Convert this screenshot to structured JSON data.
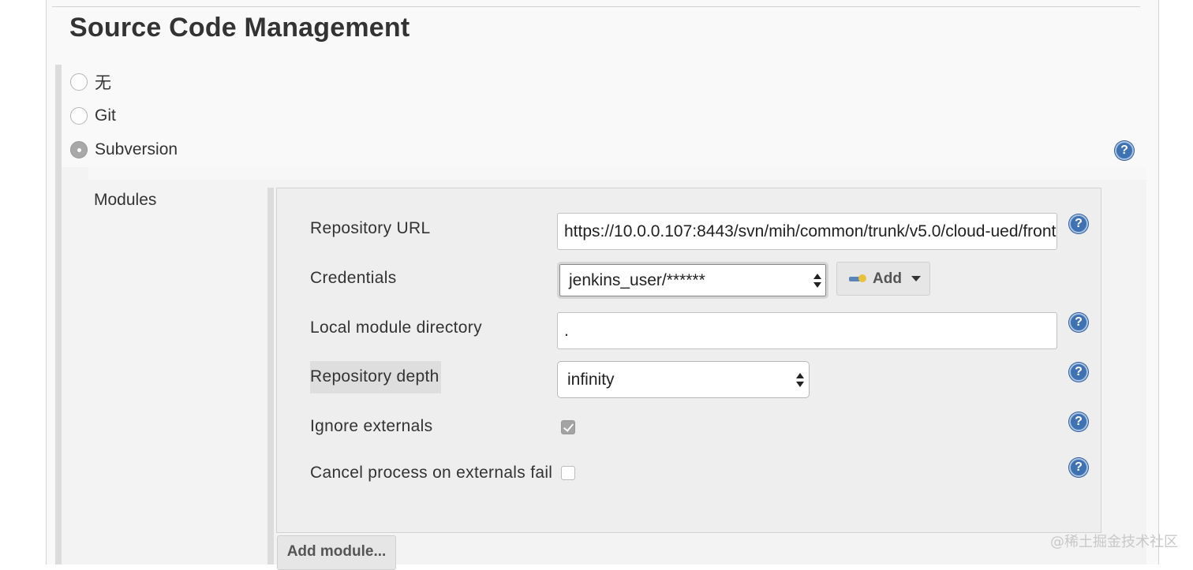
{
  "section": {
    "title": "Source Code Management"
  },
  "scm_options": [
    {
      "label": "无",
      "checked": false
    },
    {
      "label": "Git",
      "checked": false
    },
    {
      "label": "Subversion",
      "checked": true
    }
  ],
  "help_glyph": "?",
  "modules": {
    "label": "Modules",
    "repository_url": {
      "label": "Repository URL",
      "value": "https://10.0.0.107:8443/svn/mih/common/trunk/v5.0/cloud-ued/front"
    },
    "credentials": {
      "label": "Credentials",
      "selected": "jenkins_user/******",
      "add_label": "Add"
    },
    "local_module_directory": {
      "label": "Local module directory",
      "value": "."
    },
    "repository_depth": {
      "label": "Repository depth",
      "selected": "infinity"
    },
    "ignore_externals": {
      "label": "Ignore externals",
      "checked": true
    },
    "cancel_on_externals_fail": {
      "label": "Cancel process on externals fail",
      "checked": false
    },
    "add_module_label": "Add module..."
  },
  "watermark": "@稀土掘金技术社区",
  "icons": [
    "help-icon",
    "key-icon",
    "caret-down-icon",
    "updown-arrows-icon",
    "checkmark-icon"
  ]
}
